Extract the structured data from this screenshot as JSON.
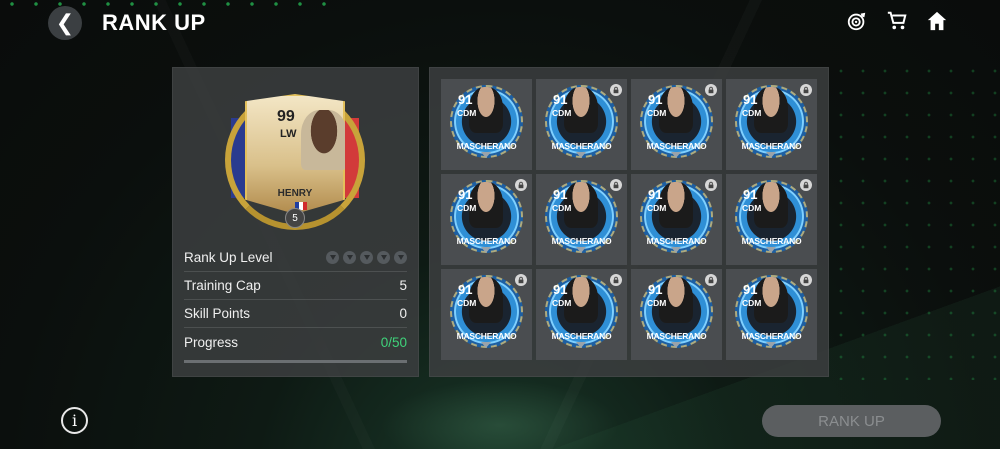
{
  "header": {
    "back_glyph": "❮",
    "title": "RANK UP",
    "icons": [
      "target-icon",
      "cart-icon",
      "home-icon"
    ]
  },
  "player_card": {
    "ovr": "99",
    "position": "LW",
    "name": "HENRY",
    "nation": "France",
    "rank_badge": "5"
  },
  "stats": {
    "rank_up_level_label": "Rank Up Level",
    "rank_up_level_pips": 5,
    "training_cap_label": "Training Cap",
    "training_cap_value": "5",
    "skill_points_label": "Skill Points",
    "skill_points_value": "0",
    "progress_label": "Progress",
    "progress_value": "0/50",
    "progress_fraction": 0
  },
  "slots": [
    {
      "ovr": "91",
      "pos": "CDM",
      "name": "MASCHERANO",
      "locked": false
    },
    {
      "ovr": "91",
      "pos": "CDM",
      "name": "MASCHERANO",
      "locked": true
    },
    {
      "ovr": "91",
      "pos": "CDM",
      "name": "MASCHERANO",
      "locked": true
    },
    {
      "ovr": "91",
      "pos": "CDM",
      "name": "MASCHERANO",
      "locked": true
    },
    {
      "ovr": "91",
      "pos": "CDM",
      "name": "MASCHERANO",
      "locked": true
    },
    {
      "ovr": "91",
      "pos": "CDM",
      "name": "MASCHERANO",
      "locked": true
    },
    {
      "ovr": "91",
      "pos": "CDM",
      "name": "MASCHERANO",
      "locked": true
    },
    {
      "ovr": "91",
      "pos": "CDM",
      "name": "MASCHERANO",
      "locked": true
    },
    {
      "ovr": "91",
      "pos": "CDM",
      "name": "MASCHERANO",
      "locked": true
    },
    {
      "ovr": "91",
      "pos": "CDM",
      "name": "MASCHERANO",
      "locked": true
    },
    {
      "ovr": "91",
      "pos": "CDM",
      "name": "MASCHERANO",
      "locked": true
    },
    {
      "ovr": "91",
      "pos": "CDM",
      "name": "MASCHERANO",
      "locked": true
    }
  ],
  "footer": {
    "info_glyph": "i",
    "rank_up_button": "RANK UP"
  },
  "colors": {
    "progress_green": "#3fd27a",
    "panel_bg": "#3c3e40",
    "button_disabled": "#5b5e60"
  }
}
